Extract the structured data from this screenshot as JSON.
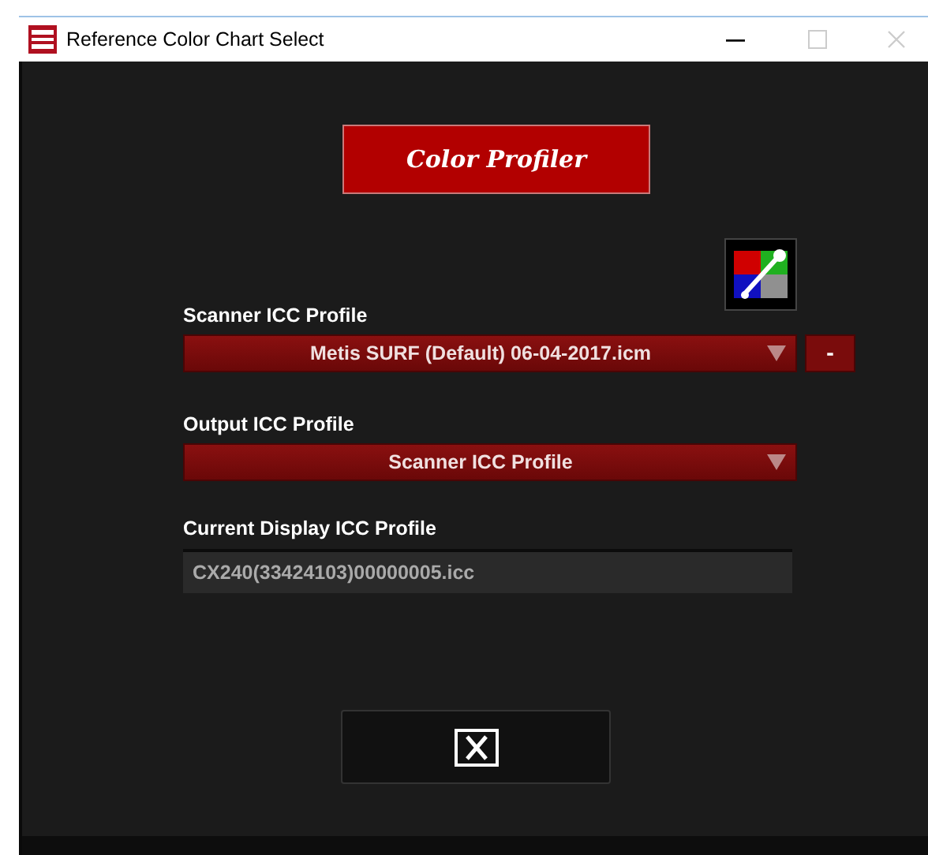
{
  "window": {
    "title": "Reference Color Chart Select"
  },
  "banner": {
    "text": "Color Profiler"
  },
  "scanner_profile": {
    "label": "Scanner ICC Profile",
    "value": "Metis SURF (Default) 06-04-2017.icm",
    "remove_button": "-"
  },
  "output_profile": {
    "label": "Output ICC Profile",
    "value": "Scanner ICC Profile"
  },
  "display_profile": {
    "label": "Current Display ICC Profile",
    "value": "CX240(33424103)00000005.icc"
  }
}
